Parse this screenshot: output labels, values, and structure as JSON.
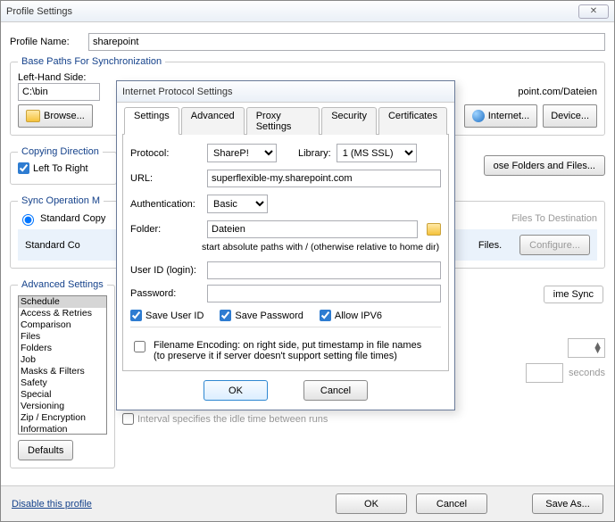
{
  "main": {
    "title": "Profile Settings",
    "profile_name_label": "Profile Name:",
    "profile_name": "sharepoint",
    "base_paths_legend": "Base Paths For Synchronization",
    "left_side_label": "Left-Hand Side:",
    "left_side_value": "C:\\bin",
    "right_side_suffix": "point.com/Dateien",
    "browse": "Browse...",
    "internet": "Internet...",
    "device": "Device...",
    "copy_dir_legend": "Copying Direction",
    "left_to_right": "Left To Right",
    "choose_folders": "ose Folders and Files...",
    "sync_op_legend": "Sync Operation M",
    "standard_copy": "Standard Copy",
    "standard_cc": "Standard Co",
    "files_to_dest": "Files To Destination",
    "files_period": "Files.",
    "configure": "Configure...",
    "advanced_legend": "Advanced Settings",
    "adv_items": [
      "Schedule",
      "Access & Retries",
      "Comparison",
      "Files",
      "Folders",
      "Job",
      "Masks & Filters",
      "Safety",
      "Special",
      "Versioning",
      "Zip / Encryption",
      "Information"
    ],
    "defaults": "Defaults",
    "ime_sync": "ime Sync",
    "seconds": "seconds",
    "interval_idle": "Interval specifies the idle time between runs",
    "disable_profile": "Disable this profile",
    "ok": "OK",
    "cancel": "Cancel",
    "save_as": "Save As..."
  },
  "modal": {
    "title": "Internet Protocol Settings",
    "tabs": [
      "Settings",
      "Advanced",
      "Proxy Settings",
      "Security",
      "Certificates"
    ],
    "protocol_label": "Protocol:",
    "protocol_value": "ShareP!",
    "library_label": "Library:",
    "library_value": "1 (MS SSL)",
    "url_label": "URL:",
    "url_value": "superflexible-my.sharepoint.com",
    "auth_label": "Authentication:",
    "auth_value": "Basic",
    "folder_label": "Folder:",
    "folder_value": "Dateien",
    "abs_path_note": "start absolute paths with /    (otherwise relative to home dir)",
    "userid_label": "User ID (login):",
    "userid_value": "",
    "password_label": "Password:",
    "password_value": "",
    "save_userid": "Save User ID",
    "save_password": "Save Password",
    "allow_ipv6": "Allow IPV6",
    "filename_enc": "Filename Encoding: on right side, put timestamp in file names",
    "filename_enc_sub": "(to preserve it if server doesn't support setting file times)",
    "ok": "OK",
    "cancel": "Cancel"
  }
}
